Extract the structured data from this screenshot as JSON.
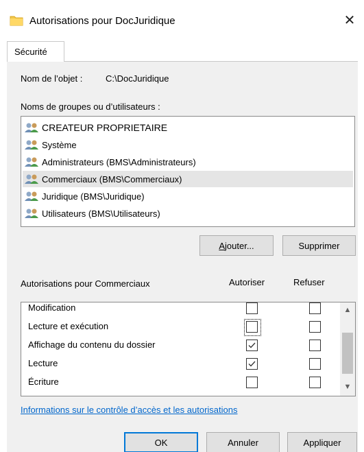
{
  "window": {
    "title": "Autorisations pour DocJuridique",
    "close_glyph": "✕",
    "folder_icon": "folder-icon"
  },
  "tab": {
    "label": "Sécurité"
  },
  "object": {
    "label": "Nom de l’objet :",
    "value": "C:\\DocJuridique"
  },
  "groups": {
    "label": "Noms de groupes ou d’utilisateurs :",
    "items": [
      {
        "label": "CREATEUR PROPRIETAIRE",
        "selected": false
      },
      {
        "label": "Système",
        "selected": false
      },
      {
        "label": "Administrateurs (BMS\\Administrateurs)",
        "selected": false
      },
      {
        "label": "Commerciaux (BMS\\Commerciaux)",
        "selected": true
      },
      {
        "label": "Juridique (BMS\\Juridique)",
        "selected": false
      },
      {
        "label": "Utilisateurs (BMS\\Utilisateurs)",
        "selected": false
      }
    ]
  },
  "buttons": {
    "add_accel": "A",
    "add_rest": "jouter...",
    "remove": "Supprimer",
    "ok": "OK",
    "cancel": "Annuler",
    "apply": "Appliquer"
  },
  "permissions": {
    "label": "Autorisations pour Commerciaux",
    "allow_header": "Autoriser",
    "deny_header": "Refuser",
    "rows": [
      {
        "label": "Modification",
        "allow": false,
        "deny": false
      },
      {
        "label": "Lecture et exécution",
        "allow": false,
        "deny": false,
        "focused": true
      },
      {
        "label": "Affichage du contenu du dossier",
        "allow": true,
        "deny": false
      },
      {
        "label": "Lecture",
        "allow": true,
        "deny": false
      },
      {
        "label": "Écriture",
        "allow": false,
        "deny": false
      }
    ]
  },
  "link": {
    "label": "Informations sur le contrôle d’accès et les autorisations"
  },
  "colors": {
    "accent": "#0078d7",
    "link": "#0066cc",
    "selected_row": "#e5e5e5"
  }
}
